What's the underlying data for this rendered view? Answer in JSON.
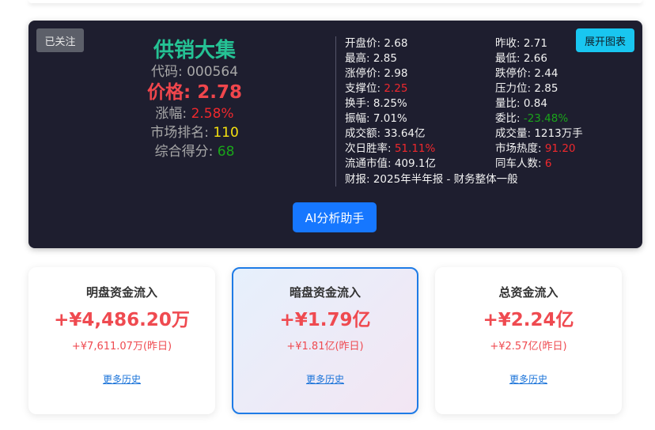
{
  "stock": {
    "follow_label": "已关注",
    "expand_label": "展开图表",
    "name": "供销大集",
    "code_label": "代码: ",
    "code": "000564",
    "price_label": "价格: ",
    "price": "2.78",
    "change_label": "涨幅: ",
    "change": "2.58%",
    "rank_label": "市场排名: ",
    "rank": "110",
    "score_label": "综合得分: ",
    "score": "68",
    "details": [
      {
        "label": "开盘价: ",
        "value": "2.68",
        "color": "normal"
      },
      {
        "label": "昨收: ",
        "value": "2.71",
        "color": "normal"
      },
      {
        "label": "最高: ",
        "value": "2.85",
        "color": "normal"
      },
      {
        "label": "最低: ",
        "value": "2.66",
        "color": "normal"
      },
      {
        "label": "涨停价: ",
        "value": "2.98",
        "color": "normal"
      },
      {
        "label": "跌停价: ",
        "value": "2.44",
        "color": "normal"
      },
      {
        "label": "支撑位: ",
        "value": "2.25",
        "color": "red"
      },
      {
        "label": "压力位: ",
        "value": "2.85",
        "color": "normal"
      },
      {
        "label": "换手: ",
        "value": "8.25%",
        "color": "normal"
      },
      {
        "label": "量比: ",
        "value": "0.84",
        "color": "normal"
      },
      {
        "label": "振幅: ",
        "value": "7.01%",
        "color": "normal"
      },
      {
        "label": "委比: ",
        "value": "-23.48%",
        "color": "green"
      },
      {
        "label": "成交额: ",
        "value": "33.64亿",
        "color": "normal"
      },
      {
        "label": "成交量: ",
        "value": "1213万手",
        "color": "normal"
      },
      {
        "label": "次日胜率: ",
        "value": "51.11%",
        "color": "red"
      },
      {
        "label": "市场热度: ",
        "value": "91.20",
        "color": "red"
      },
      {
        "label": "流通市值: ",
        "value": "409.1亿",
        "color": "normal"
      },
      {
        "label": "同车人数: ",
        "value": "6",
        "color": "red"
      }
    ],
    "report": "财报: 2025年半年报 - 财务整体一般",
    "ai_button": "AI分析助手"
  },
  "flows": [
    {
      "title": "明盘资金流入",
      "value": "+¥4,486.20万",
      "prev": "+¥7,611.07万(昨日)",
      "link": "更多历史"
    },
    {
      "title": "暗盘资金流入",
      "value": "+¥1.79亿",
      "prev": "+¥1.81亿(昨日)",
      "link": "更多历史"
    },
    {
      "title": "总资金流入",
      "value": "+¥2.24亿",
      "prev": "+¥2.57亿(昨日)",
      "link": "更多历史"
    }
  ]
}
